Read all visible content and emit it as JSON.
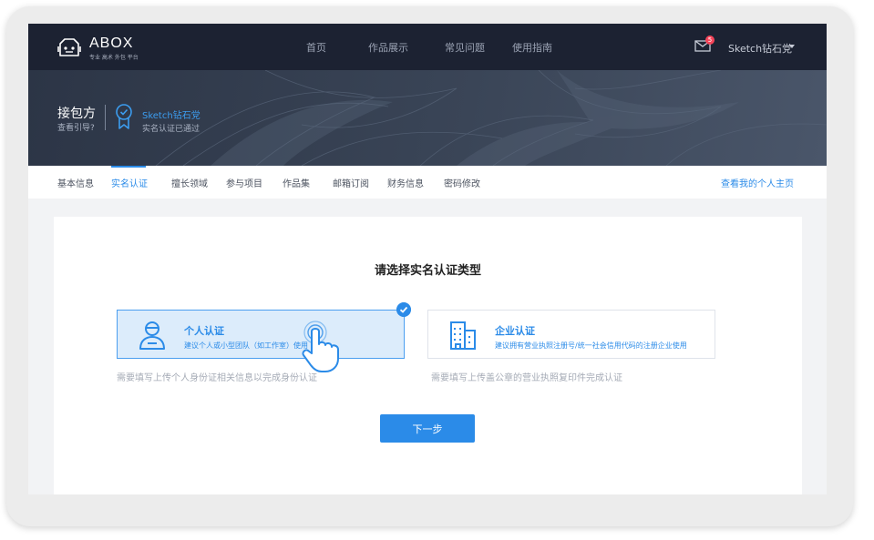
{
  "brand": {
    "name": "ABOX",
    "tagline": "专业 高术 外包 平台"
  },
  "nav": {
    "items": [
      "首页",
      "作品展示",
      "常见问题",
      "使用指南"
    ]
  },
  "user": {
    "notifications": "5",
    "name": "Sketch钻石党"
  },
  "banner": {
    "company": "接包方",
    "company_sub": "查看引导?",
    "verified_name": "Sketch钻石党",
    "verified_status": "实名认证已通过"
  },
  "tabs": {
    "items": [
      "基本信息",
      "实名认证",
      "擅长领域",
      "参与项目",
      "作品集",
      "邮箱订阅",
      "财务信息",
      "密码修改"
    ],
    "active": "实名认证",
    "homepage_link": "查看我的个人主页"
  },
  "card": {
    "title": "请选择实名认证类型",
    "options": [
      {
        "title": "个人认证",
        "desc": "建议个人或小型团队（如工作室）使用",
        "hint": "需要填写上传个人身份证相关信息以完成身份认证",
        "selected": true
      },
      {
        "title": "企业认证",
        "desc": "建议拥有营业执照注册号/统一社会信用代码的注册企业使用",
        "hint": "需要填写上传盖公章的营业执照复印件完成认证",
        "selected": false
      }
    ],
    "next_label": "下一步"
  },
  "colors": {
    "primary": "#2b8be8",
    "header": "#1c2232",
    "badge": "#f5455a"
  },
  "icons": [
    "robot-logo-icon",
    "mail-icon",
    "medal-icon",
    "person-icon",
    "building-icon",
    "check-icon",
    "pointing-hand-icon"
  ]
}
